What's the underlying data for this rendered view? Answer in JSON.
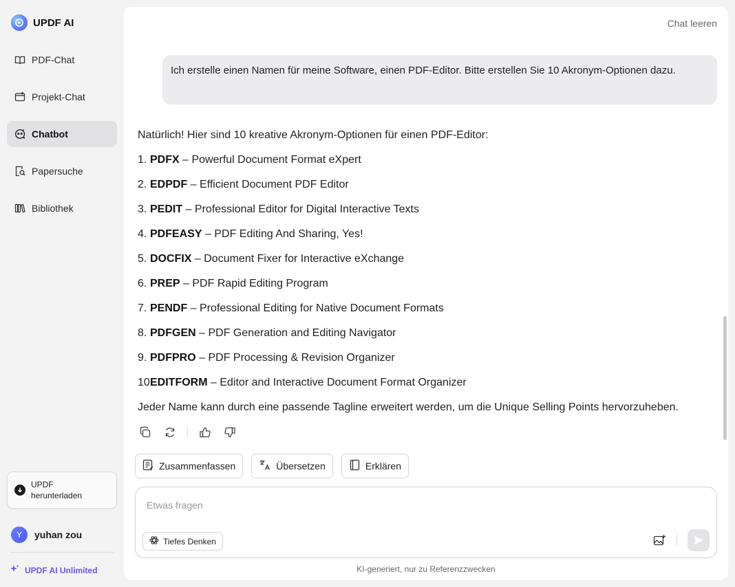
{
  "brand": {
    "name": "UPDF AI",
    "icon": "updf-logo-icon"
  },
  "sidebar": {
    "items": [
      {
        "label": "PDF-Chat",
        "icon": "book-open-icon",
        "active": false
      },
      {
        "label": "Projekt-Chat",
        "icon": "folder-add-icon",
        "active": false
      },
      {
        "label": "Chatbot",
        "icon": "chatbot-icon",
        "active": true
      },
      {
        "label": "Papersuche",
        "icon": "paper-search-icon",
        "active": false
      },
      {
        "label": "Bibliothek",
        "icon": "library-icon",
        "active": false
      }
    ],
    "download": {
      "label": "UPDF herunterladen",
      "icon": "download-icon"
    },
    "user": {
      "initial": "Y",
      "name": "yuhan zou"
    },
    "unlimited": {
      "label": "UPDF AI Unlimited",
      "icon": "sparkle-icon"
    }
  },
  "header": {
    "clear_chat": "Chat leeren"
  },
  "chat": {
    "user_message": "Ich erstelle einen Namen für meine Software, einen PDF-Editor. Bitte erstellen Sie 10 Akronym-Optionen dazu.",
    "answer_intro": "Natürlich! Hier sind 10 kreative Akronym-Optionen für einen PDF-Editor:",
    "options": [
      {
        "num": "1.",
        "name": "PDFX",
        "desc": "– Powerful Document Format eXpert"
      },
      {
        "num": "2.",
        "name": "EDPDF",
        "desc": "– Efficient Document PDF Editor"
      },
      {
        "num": "3.",
        "name": "PEDIT",
        "desc": "– Professional Editor for Digital Interactive Texts"
      },
      {
        "num": "4.",
        "name": "PDFEASY",
        "desc": "– PDF Editing And Sharing, Yes!"
      },
      {
        "num": "5.",
        "name": "DOCFIX",
        "desc": "– Document Fixer for Interactive eXchange"
      },
      {
        "num": "6.",
        "name": "PREP",
        "desc": "– PDF Rapid Editing Program"
      },
      {
        "num": "7.",
        "name": "PENDF",
        "desc": "– Professional Editing for Native Document Formats"
      },
      {
        "num": "8.",
        "name": "PDFGEN",
        "desc": "– PDF Generation and Editing Navigator"
      },
      {
        "num": "9.",
        "name": "PDFPRO",
        "desc": "– PDF Processing & Revision Organizer"
      },
      {
        "num": "10",
        "name": "EDITFORM",
        "desc": "– Editor and Interactive Document Format Organizer"
      }
    ],
    "answer_outro": "Jeder Name kann durch eine passende Tagline erweitert werden, um die Unique Selling Points hervorzuheben.",
    "actions": [
      "copy-icon",
      "regenerate-icon",
      "thumbs-up-icon",
      "thumbs-down-icon"
    ]
  },
  "quick_actions": [
    {
      "label": "Zusammenfassen",
      "icon": "summarize-icon"
    },
    {
      "label": "Übersetzen",
      "icon": "translate-icon"
    },
    {
      "label": "Erklären",
      "icon": "explain-icon"
    }
  ],
  "input": {
    "placeholder": "Etwas fragen",
    "value": "",
    "deep_think": "Tiefes Denken"
  },
  "disclaimer": "KI-generiert, nur zu Referenzzwecken",
  "colors": {
    "accent": "#6b55e8",
    "active_nav": "#e1e1e4",
    "background": "#f3f3f4"
  }
}
